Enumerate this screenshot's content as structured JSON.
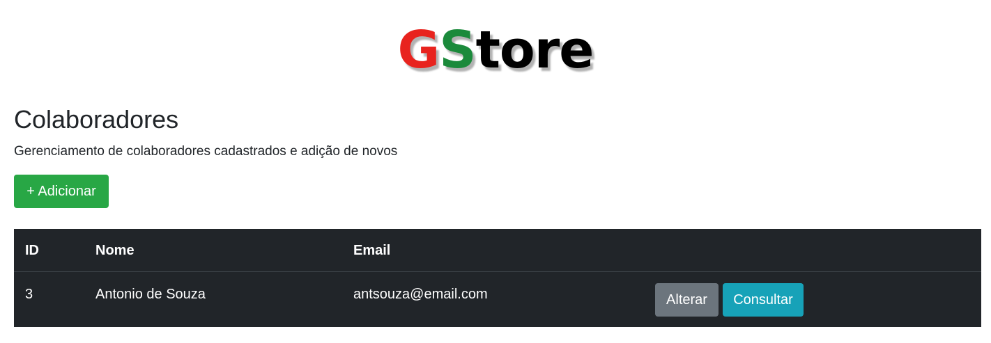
{
  "logo": {
    "part1": "G",
    "part2": "S",
    "part3": "tore"
  },
  "header": {
    "title": "Colaboradores",
    "subtitle": "Gerenciamento de colaboradores cadastrados e adição de novos"
  },
  "actions": {
    "add_label": "+ Adicionar"
  },
  "table": {
    "columns": [
      "ID",
      "Nome",
      "Email",
      ""
    ],
    "rows": [
      {
        "id": "3",
        "nome": "Antonio de Souza",
        "email": "antsouza@email.com",
        "alterar_label": "Alterar",
        "consultar_label": "Consultar"
      }
    ]
  },
  "colors": {
    "logo_g": "#e8231e",
    "logo_s": "#1b8a3b",
    "add_button": "#28a745",
    "table_bg": "#212529",
    "alterar_button": "#6c757d",
    "consultar_button": "#17a2b8"
  }
}
